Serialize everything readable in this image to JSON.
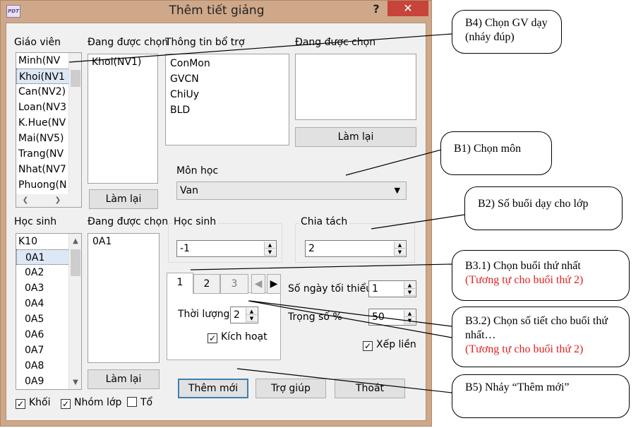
{
  "window": {
    "title": "Thêm tiết giảng",
    "icon_text": "PDT",
    "help": "?",
    "close": "✕"
  },
  "teachers": {
    "label": "Giáo viên",
    "items": [
      "Minh(NV",
      "Khoi(NV1",
      "Can(NV2)",
      "Loan(NV3",
      "K.Hue(NV",
      "Mai(NV5)",
      "Trang(NV",
      "Nhat(NV7",
      "Phuong(N"
    ],
    "selected_label": "Đang được chọn",
    "selected_items": [
      "Khoi(NV1)"
    ],
    "reset": "Làm lại"
  },
  "extra": {
    "label": "Thông tin bổ trợ",
    "items": [
      "ConMon",
      "GVCN",
      "ChiUy",
      "BLD"
    ],
    "selected_label": "Đang được chọn",
    "reset": "Làm lại"
  },
  "subject": {
    "label": "Môn học",
    "value": "Van"
  },
  "students": {
    "label": "Học sinh",
    "items": [
      "K10",
      "0A1",
      "0A2",
      "0A3",
      "0A4",
      "0A5",
      "0A6",
      "0A7",
      "0A8",
      "0A9"
    ],
    "selected_label": "Đang được chọn",
    "selected_items": [
      "0A1"
    ],
    "reset": "Làm lại"
  },
  "hoc_sinh_group": {
    "label": "Học sinh",
    "value": "-1"
  },
  "chia_tach_group": {
    "label": "Chia tách",
    "value": "2"
  },
  "tabs": [
    "1",
    "2",
    "3"
  ],
  "tab_panel": {
    "duration_label": "Thời lượng",
    "duration_value": "2",
    "activate_label": "Kích hoạt",
    "activate_checked": true
  },
  "min_days": {
    "label": "Số ngày tối thiểu",
    "value": "1"
  },
  "weight": {
    "label": "Trọng số %",
    "value": "50"
  },
  "consecutive": {
    "label": "Xếp liền",
    "checked": true
  },
  "filters": {
    "khoi": "Khối",
    "nhom_lop": "Nhóm lớp",
    "to": "Tổ"
  },
  "buttons": {
    "add": "Thêm mới",
    "help": "Trợ giúp",
    "exit": "Thoát"
  },
  "callouts": {
    "b4": "B4) Chọn GV dạy (nháy đúp)",
    "b1": "B1) Chọn môn",
    "b2": "B2) Số buổi dạy cho lớp",
    "b31": "B3.1) Chọn buổi thứ nhất",
    "b31_note": "(Tương tự cho buổi thứ 2)",
    "b32": "B3.2) Chọn số tiết cho buổi thứ nhất…",
    "b32_note": "(Tương tự cho buổi thứ 2)",
    "b5": "B5) Nháy “Thêm mới”"
  }
}
